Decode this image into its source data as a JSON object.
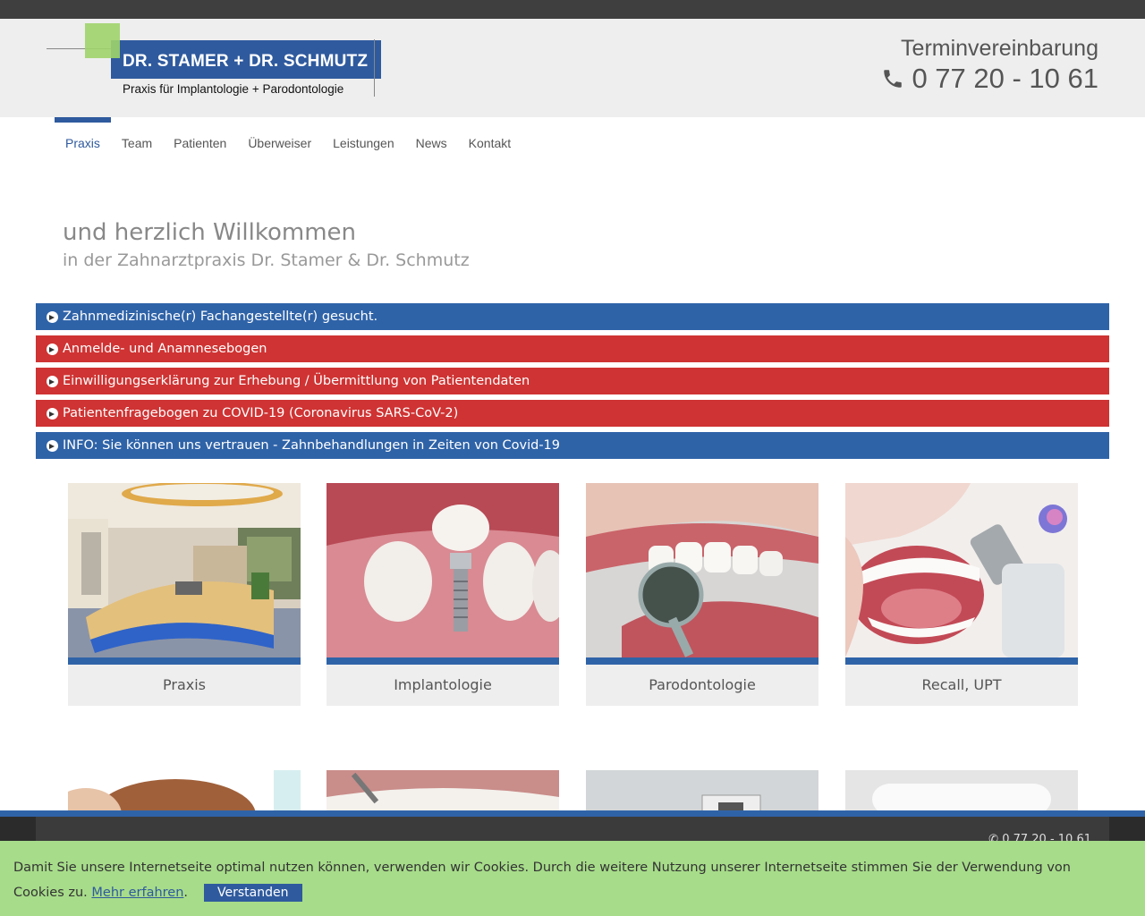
{
  "header": {
    "logo_title": "DR. STAMER + DR. SCHMUTZ",
    "logo_subtitle": "Praxis für Implantologie + Parodontologie",
    "appointment_title": "Terminvereinbarung",
    "appointment_phone": "0 77 20 - 10 61"
  },
  "nav": {
    "items": [
      "Praxis",
      "Team",
      "Patienten",
      "Überweiser",
      "Leistungen",
      "News",
      "Kontakt"
    ],
    "active": "Praxis"
  },
  "welcome": {
    "title": "und herzlich Willkommen",
    "subtitle": "in der Zahnarztpraxis Dr. Stamer & Dr. Schmutz"
  },
  "bars": [
    {
      "label": "Zahnmedizinische(r) Fachangestellte(r) gesucht.",
      "color": "#2f63a8"
    },
    {
      "label": "Anmelde- und Anamnesebogen",
      "color": "#cf3333"
    },
    {
      "label": "Einwilligungserklärung zur Erhebung / Übermittlung von Patientendaten",
      "color": "#cf3333"
    },
    {
      "label": "Patientenfragebogen zu COVID-19 (Coronavirus SARS-CoV-2)",
      "color": "#cf3333"
    },
    {
      "label": "INFO: Sie können uns vertrauen - Zahnbehandlungen in Zeiten von Covid-19",
      "color": "#2f63a8"
    }
  ],
  "tiles": [
    {
      "label": "Praxis"
    },
    {
      "label": "Implantologie"
    },
    {
      "label": "Parodontologie"
    },
    {
      "label": "Recall, UPT"
    }
  ],
  "footer": {
    "phone": "0 77 20 - 10 61"
  },
  "cookie": {
    "text": "Damit Sie unsere Internetseite optimal nutzen können, verwenden wir Cookies. Durch die weitere Nutzung unserer Internetseite stimmen Sie der Verwendung von Cookies zu.",
    "link": "Mehr erfahren",
    "accept": "Verstanden"
  },
  "colors": {
    "brand_blue": "#2f5a9e",
    "bar_blue": "#2f63a8",
    "bar_red": "#cf3333",
    "logo_green": "#9ed36a",
    "cookie_green": "#a7dc8a"
  }
}
